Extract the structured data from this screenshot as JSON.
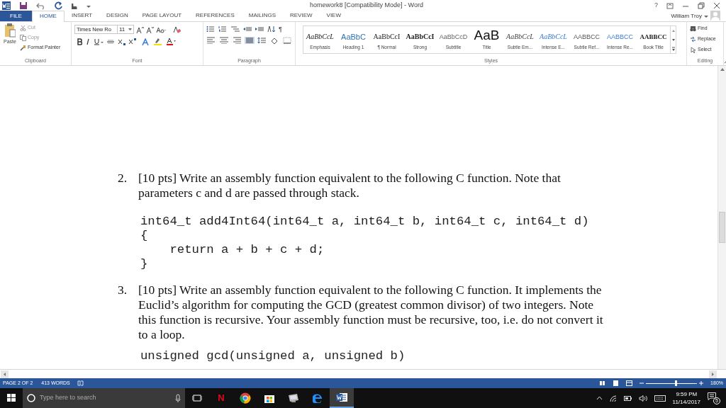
{
  "title_bar": {
    "title": "homework8 [Compatibility Mode] - Word",
    "help": "?",
    "user": "William Troy"
  },
  "tabs": [
    {
      "label": "FILE",
      "kind": "file",
      "selected": false
    },
    {
      "label": "HOME",
      "kind": "tab",
      "selected": true
    },
    {
      "label": "INSERT",
      "kind": "tab",
      "selected": false
    },
    {
      "label": "DESIGN",
      "kind": "tab",
      "selected": false
    },
    {
      "label": "PAGE LAYOUT",
      "kind": "tab",
      "selected": false
    },
    {
      "label": "REFERENCES",
      "kind": "tab",
      "selected": false
    },
    {
      "label": "MAILINGS",
      "kind": "tab",
      "selected": false
    },
    {
      "label": "REVIEW",
      "kind": "tab",
      "selected": false
    },
    {
      "label": "VIEW",
      "kind": "tab",
      "selected": false
    }
  ],
  "clipboard": {
    "paste": "Paste",
    "cut": "Cut",
    "copy": "Copy",
    "format_painter": "Format Painter",
    "label": "Clipboard"
  },
  "font": {
    "font_name": "Times New Ro",
    "font_size": "11",
    "label": "Font"
  },
  "paragraph": {
    "label": "Paragraph",
    "pilcrow": "¶"
  },
  "styles": {
    "label": "Styles",
    "items": [
      {
        "preview": "AaBbCcL",
        "name": "Emphasis",
        "kind": "emphasis"
      },
      {
        "preview": "AaBbC",
        "name": "Heading 1",
        "kind": "heading"
      },
      {
        "preview": "AaBbCcI",
        "name": "¶ Normal",
        "kind": "normal"
      },
      {
        "preview": "AaBbCcI",
        "name": "Strong",
        "kind": "strong"
      },
      {
        "preview": "AaBbCcD",
        "name": "Subtitle",
        "kind": "subtitle"
      },
      {
        "preview": "AaB",
        "name": "Title",
        "kind": "title"
      },
      {
        "preview": "AaBbCcL",
        "name": "Subtle Em...",
        "kind": "subtle-emphasis"
      },
      {
        "preview": "AaBbCcL",
        "name": "Intense E...",
        "kind": "intense-emphasis"
      },
      {
        "preview": "AABBCC",
        "name": "Subtle Ref...",
        "kind": "subtle-reference"
      },
      {
        "preview": "AABBCC",
        "name": "Intense Re...",
        "kind": "intense-reference"
      },
      {
        "preview": "AABBCC",
        "name": "Book Title",
        "kind": "book-title"
      }
    ]
  },
  "editing": {
    "label": "Editing",
    "find": "Find",
    "replace": "Replace",
    "select": "Select"
  },
  "document": {
    "questions": [
      {
        "number": "2.",
        "text": "[10 pts] Write an assembly function equivalent to the following C function. Note that parameters c and d are passed through stack.",
        "code": [
          "int64_t add4Int64(int64_t a, int64_t b, int64_t c, int64_t d)",
          "{",
          "    return a + b + c + d;",
          "}"
        ]
      },
      {
        "number": "3.",
        "text": "[10 pts] Write an assembly function equivalent to the following C function. It implements the Euclid’s algorithm for computing the GCD (greatest common divisor) of two integers. Note this function is recursive. Your assembly function must be recursive, too, i.e. do not convert it to a loop.",
        "code": [
          "unsigned gcd(unsigned a, unsigned b)"
        ]
      }
    ]
  },
  "status_bar": {
    "page": "PAGE 2 OF 2",
    "words": "413 WORDS",
    "zoom": "180%",
    "zoom_slider": {
      "level": 0.6
    }
  },
  "taskbar": {
    "search_placeholder": "Type here to search",
    "netflix": "N",
    "time": "9:59 PM",
    "date": "11/14/2017",
    "notifications": "5"
  }
}
